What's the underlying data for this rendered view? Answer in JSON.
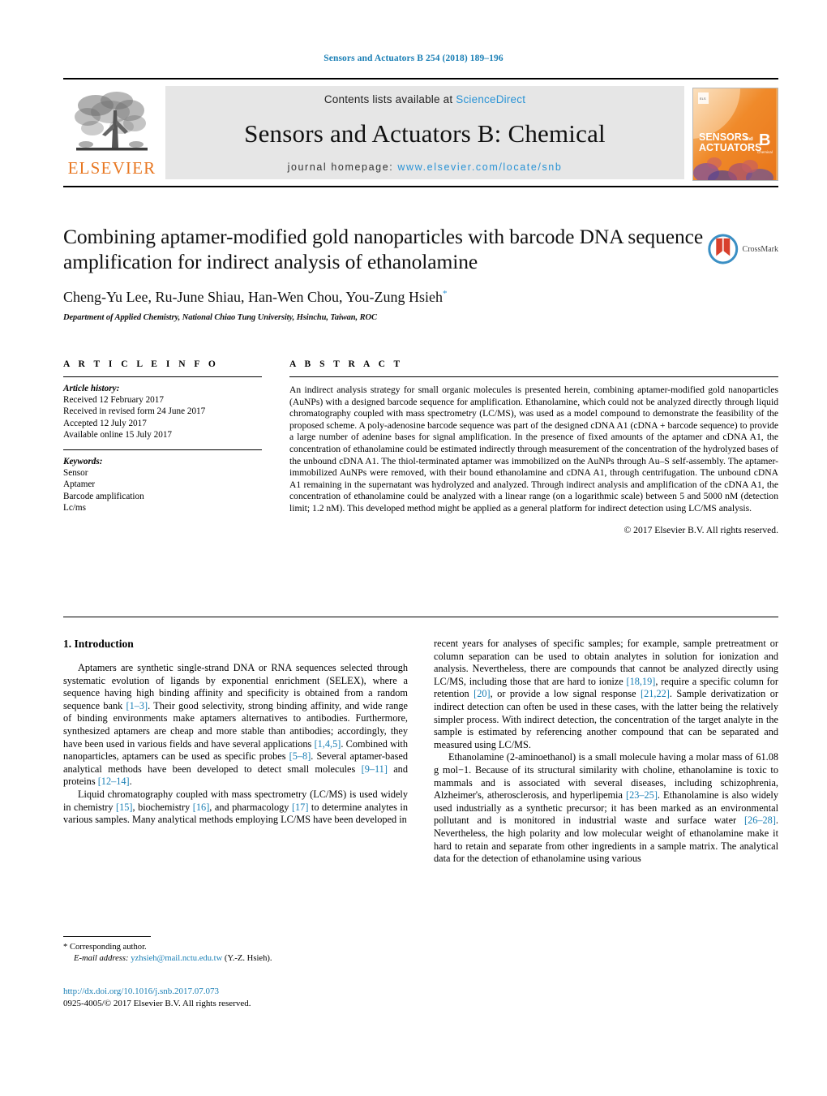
{
  "running_head": "Sensors and Actuators B 254 (2018) 189–196",
  "masthead": {
    "contents_prefix": "Contents lists available at ",
    "sciencedirect": "ScienceDirect",
    "journal_title": "Sensors and Actuators B: Chemical",
    "homepage_prefix": "journal homepage: ",
    "homepage_url": "www.elsevier.com/locate/snb",
    "publisher": "ELSEVIER",
    "cover_line1": "SENSORS",
    "cover_and": "and",
    "cover_line2": "ACTUATORS",
    "cover_letter": "B",
    "cover_sub": "Chemical",
    "accent_orange": "#E87722",
    "accent_blue": "#2a93d5"
  },
  "article": {
    "title": "Combining aptamer-modified gold nanoparticles with barcode DNA sequence amplification for indirect analysis of ethanolamine",
    "authors": "Cheng-Yu Lee, Ru-June Shiau, Han-Wen Chou, You-Zung Hsieh",
    "corresponding_marker": "*",
    "affiliation": "Department of Applied Chemistry, National Chiao Tung University, Hsinchu, Taiwan, ROC",
    "crossmark_label": "CrossMark"
  },
  "article_info": {
    "heading": "A R T I C L E   I N F O",
    "history_label": "Article history:",
    "history": [
      "Received 12 February 2017",
      "Received in revised form 24 June 2017",
      "Accepted 12 July 2017",
      "Available online 15 July 2017"
    ],
    "keywords_label": "Keywords:",
    "keywords": [
      "Sensor",
      "Aptamer",
      "Barcode amplification",
      "Lc/ms"
    ]
  },
  "abstract": {
    "heading": "A B S T R A C T",
    "text": "An indirect analysis strategy for small organic molecules is presented herein, combining aptamer-modified gold nanoparticles (AuNPs) with a designed barcode sequence for amplification. Ethanolamine, which could not be analyzed directly through liquid chromatography coupled with mass spectrometry (LC/MS), was used as a model compound to demonstrate the feasibility of the proposed scheme. A poly-adenosine barcode sequence was part of the designed cDNA A1 (cDNA + barcode sequence) to provide a large number of adenine bases for signal amplification. In the presence of fixed amounts of the aptamer and cDNA A1, the concentration of ethanolamine could be estimated indirectly through measurement of the concentration of the hydrolyzed bases of the unbound cDNA A1. The thiol-terminated aptamer was immobilized on the AuNPs through Au–S self-assembly. The aptamer-immobilized AuNPs were removed, with their bound ethanolamine and cDNA A1, through centrifugation. The unbound cDNA A1 remaining in the supernatant was hydrolyzed and analyzed. Through indirect analysis and amplification of the cDNA A1, the concentration of ethanolamine could be analyzed with a linear range (on a logarithmic scale) between 5 and 5000 nM (detection limit; 1.2 nM). This developed method might be applied as a general platform for indirect detection using LC/MS analysis.",
    "copyright": "© 2017 Elsevier B.V. All rights reserved."
  },
  "introduction": {
    "heading": "1.  Introduction",
    "left_paragraphs": [
      {
        "runs": [
          {
            "t": "Aptamers are synthetic single-strand DNA or RNA sequences selected through systematic evolution of ligands by exponential enrichment (SELEX), where a sequence having high binding affinity and specificity is obtained from a random sequence bank "
          },
          {
            "t": "[1–3]",
            "ref": true
          },
          {
            "t": ". Their good selectivity, strong binding affinity, and wide range of binding environments make aptamers alternatives to antibodies. Furthermore, synthesized aptamers are cheap and more stable than antibodies; accordingly, they have been used in various fields and have several applications "
          },
          {
            "t": "[1,4,5]",
            "ref": true
          },
          {
            "t": ". Combined with nanoparticles, aptamers can be used as specific probes "
          },
          {
            "t": "[5–8]",
            "ref": true
          },
          {
            "t": ". Several aptamer-based analytical methods have been developed to detect small molecules "
          },
          {
            "t": "[9–11]",
            "ref": true
          },
          {
            "t": " and proteins "
          },
          {
            "t": "[12–14]",
            "ref": true
          },
          {
            "t": "."
          }
        ]
      },
      {
        "runs": [
          {
            "t": "Liquid chromatography coupled with mass spectrometry (LC/MS) is used widely in chemistry "
          },
          {
            "t": "[15]",
            "ref": true
          },
          {
            "t": ", biochemistry "
          },
          {
            "t": "[16]",
            "ref": true
          },
          {
            "t": ", and pharmacology "
          },
          {
            "t": "[17]",
            "ref": true
          },
          {
            "t": " to determine analytes in various samples. Many analytical methods employing LC/MS have been developed in"
          }
        ]
      }
    ],
    "right_paragraphs": [
      {
        "runs": [
          {
            "t": "recent years for analyses of specific samples; for example, sample pretreatment or column separation can be used to obtain analytes in solution for ionization and analysis. Nevertheless, there are compounds that cannot be analyzed directly using LC/MS, including those that are hard to ionize "
          },
          {
            "t": "[18,19]",
            "ref": true
          },
          {
            "t": ", require a specific column for retention "
          },
          {
            "t": "[20]",
            "ref": true
          },
          {
            "t": ", or provide a low signal response "
          },
          {
            "t": "[21,22]",
            "ref": true
          },
          {
            "t": ". Sample derivatization or indirect detection can often be used in these cases, with the latter being the relatively simpler process. With indirect detection, the concentration of the target analyte in the sample is estimated by referencing another compound that can be separated and measured using LC/MS."
          }
        ],
        "no_indent": true
      },
      {
        "runs": [
          {
            "t": "Ethanolamine (2-aminoethanol) is a small molecule having a molar mass of 61.08 g mol−1. Because of its structural similarity with choline, ethanolamine is toxic to mammals and is associated with several diseases, including schizophrenia, Alzheimer's, atherosclerosis, and hyperlipemia "
          },
          {
            "t": "[23–25]",
            "ref": true
          },
          {
            "t": ". Ethanolamine is also widely used industrially as a synthetic precursor; it has been marked as an environmental pollutant and is monitored in industrial waste and surface water "
          },
          {
            "t": "[26–28]",
            "ref": true
          },
          {
            "t": ". Nevertheless, the high polarity and low molecular weight of ethanolamine make it hard to retain and separate from other ingredients in a sample matrix. The analytical data for the detection of ethanolamine using various"
          }
        ]
      }
    ]
  },
  "footnotes": {
    "corresponding": "*  Corresponding author.",
    "email_label": "E-mail address:",
    "email": "yzhsieh@mail.nctu.edu.tw",
    "email_suffix": "(Y.-Z. Hsieh)."
  },
  "footer": {
    "doi": "http://dx.doi.org/10.1016/j.snb.2017.07.073",
    "issn_line": "0925-4005/© 2017 Elsevier B.V. All rights reserved."
  }
}
